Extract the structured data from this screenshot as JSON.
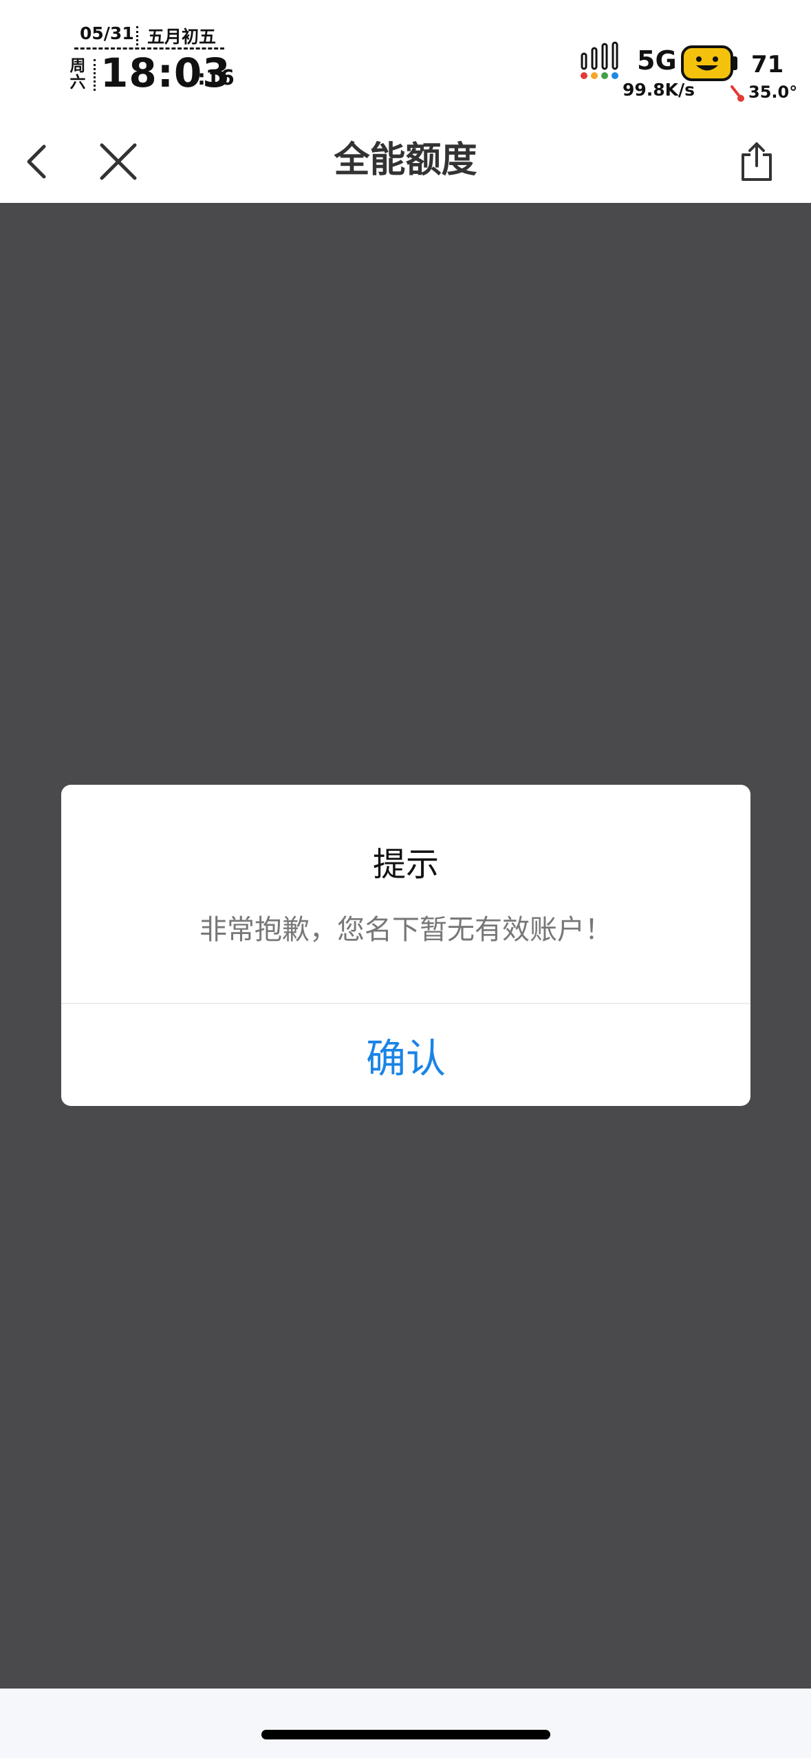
{
  "status_bar": {
    "date": "05/31",
    "lunar_date": "五月初五",
    "weekday": "周六",
    "time": "18:03",
    "seconds": ":16",
    "network_type": "5G",
    "network_speed": "99.8K/s",
    "battery_level": "71",
    "temperature": "35.0°",
    "icons": [
      "signal-bars-icon",
      "mascot-battery-icon",
      "thermometer-icon"
    ]
  },
  "nav": {
    "title": "全能额度",
    "back_icon": "chevron-left-icon",
    "close_icon": "close-icon",
    "share_icon": "share-icon"
  },
  "dialog": {
    "title": "提示",
    "message": "非常抱歉，您名下暂无有效账户！",
    "confirm_label": "确认"
  },
  "colors": {
    "overlay": "#4a4a4c",
    "accent": "#1a84e6",
    "message_text": "#777777",
    "bottom_bar": "#f6f7fa"
  }
}
